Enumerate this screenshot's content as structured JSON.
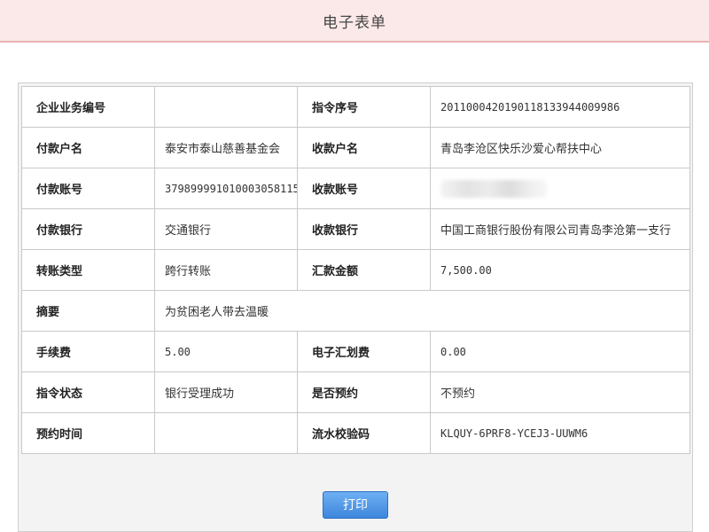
{
  "header": {
    "title": "电子表单"
  },
  "form": {
    "rows": [
      {
        "label1": "企业业务编号",
        "value1": "",
        "label2": "指令序号",
        "value2": "20110004201901181339440099​86"
      },
      {
        "label1": "付款户名",
        "value1": "泰安市泰山慈善基金会",
        "label2": "收款户名",
        "value2": "青岛李沧区快乐沙爱心帮扶中心"
      },
      {
        "label1": "付款账号",
        "value1": "379899991010003058115",
        "label2": "收款账号",
        "value2": ""
      },
      {
        "label1": "付款银行",
        "value1": "交通银行",
        "label2": "收款银行",
        "value2": "中国工商银行股份有限公司青岛李沧第一支行"
      },
      {
        "label1": "转账类型",
        "value1": "跨行转账",
        "label2": "汇款金额",
        "value2": "7,500.00"
      },
      {
        "label1": "摘要",
        "value1": "为贫困老人带去温暖"
      },
      {
        "label1": "手续费",
        "value1": "5.00",
        "label2": "电子汇划费",
        "value2": "0.00"
      },
      {
        "label1": "指令状态",
        "value1": "银行受理成功",
        "label2": "是否预约",
        "value2": "不预约"
      },
      {
        "label1": "预约时间",
        "value1": "",
        "label2": "流水校验码",
        "value2": "KLQUY-6PRF8-YCEJ3-UUWM6"
      }
    ]
  },
  "footer": {
    "print_label": "打印"
  },
  "colors": {
    "header_bg": "#fbe9e9",
    "button": "#3d86dc"
  }
}
